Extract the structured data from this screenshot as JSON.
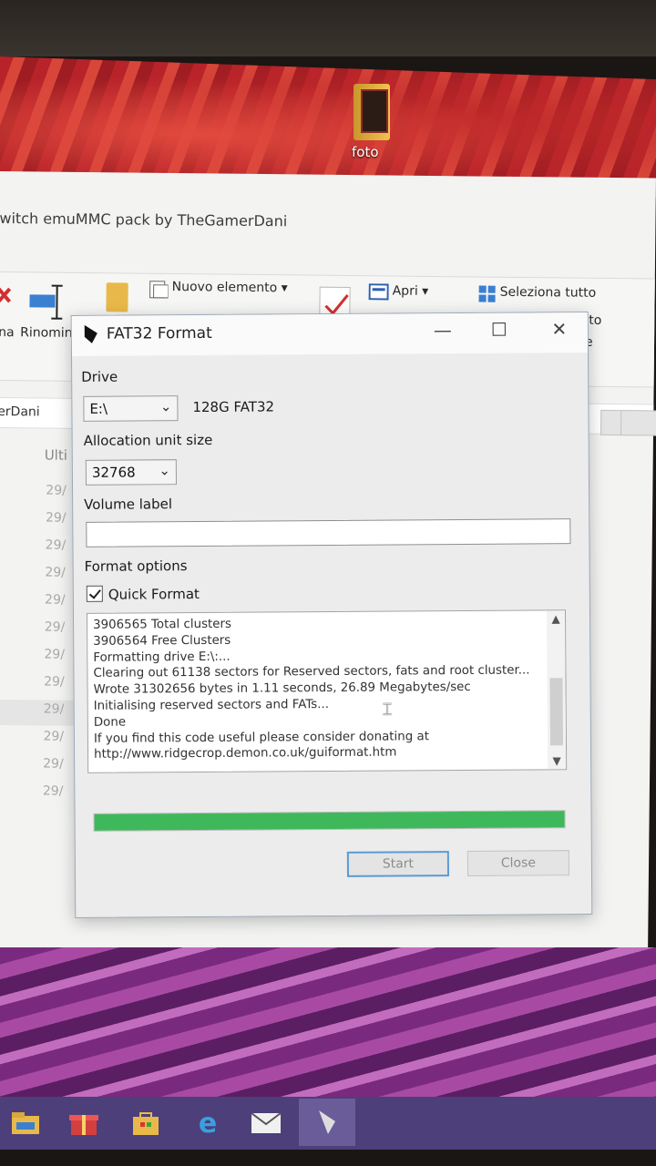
{
  "desktop": {
    "icon_label": "foto"
  },
  "explorer": {
    "title": "witch emuMMC pack by TheGamerDani",
    "ribbon": {
      "rename_left": "na",
      "rename": "Rinomin",
      "new_item": "Nuovo elemento",
      "open": "Apri",
      "select_all": "Seleziona tutto",
      "partial_1": "to",
      "partial_2": "e"
    },
    "address": "erDani",
    "column_header": "Ulti",
    "dates": [
      "29/",
      "29/",
      "29/",
      "29/",
      "29/",
      "29/",
      "29/",
      "29/",
      "29/",
      "29/",
      "29/",
      "29/"
    ]
  },
  "dialog": {
    "title": "FAT32 Format",
    "drive_label": "Drive",
    "drive_value": "E:\\",
    "drive_info": "128G FAT32",
    "alloc_label": "Allocation unit size",
    "alloc_value": "32768",
    "volume_label": "Volume label",
    "volume_value": "",
    "format_options_label": "Format options",
    "quick_format_label": "Quick Format",
    "quick_format_checked": true,
    "log_lines": [
      "3906565 Total clusters",
      "3906564 Free Clusters",
      "Formatting drive E:\\:...",
      "Clearing out 61138 sectors for Reserved sectors, fats and root cluster...",
      "Wrote 31302656 bytes in 1.11 seconds, 26.89 Megabytes/sec",
      "Initialising reserved sectors and FATs...",
      "Done",
      "If you find this code useful please consider donating at",
      "http://www.ridgecrop.demon.co.uk/guiformat.htm"
    ],
    "progress_percent": 100,
    "progress_color": "#3fb85b",
    "start_label": "Start",
    "close_label": "Close"
  },
  "taskbar": {
    "color": "#4d3f7a",
    "items": [
      "file-explorer-icon",
      "gift-icon",
      "store-icon",
      "edge-icon",
      "mail-icon",
      "fat32-format-icon"
    ]
  }
}
